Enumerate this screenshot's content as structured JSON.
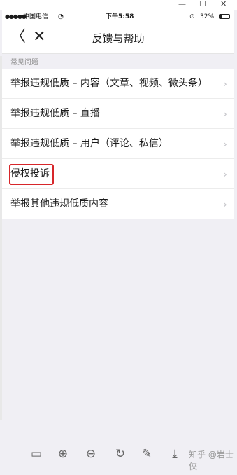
{
  "window": {
    "minimize": "—",
    "maximize": "☐",
    "close": "✕"
  },
  "status": {
    "signal": "●●●●●",
    "carrier": "中国电信",
    "wifi": "◔",
    "time": "下午5:58",
    "battery_percent": "32%",
    "battery_level": 0.32
  },
  "nav": {
    "back": "〈",
    "close": "✕",
    "title": "反馈与帮助"
  },
  "section": {
    "header": "常见问题"
  },
  "items": [
    {
      "label": "举报违规低质 – 内容（文章、视频、微头条）"
    },
    {
      "label": "举报违规低质 – 直播"
    },
    {
      "label": "举报违规低质 – 用户（评论、私信）"
    },
    {
      "label": "侵权投诉"
    },
    {
      "label": "举报其他违规低质内容"
    }
  ],
  "chevron": "›",
  "toolbar": {
    "tools": [
      "▭",
      "⊕",
      "⊖",
      "↻",
      "✎",
      "⤓"
    ],
    "watermark": "知乎 @岩士侠"
  }
}
